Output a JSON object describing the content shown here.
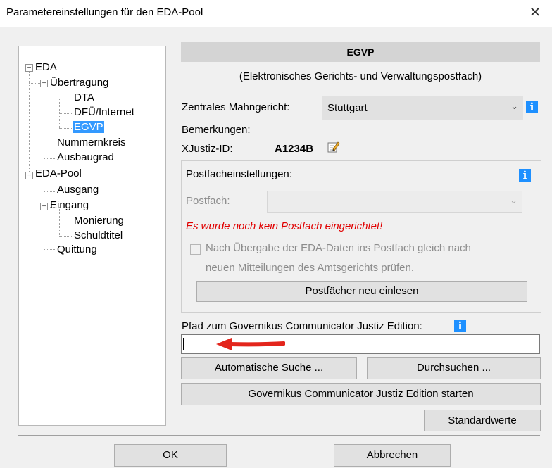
{
  "window": {
    "title": "Parametereinstellungen für den EDA-Pool",
    "close_glyph": "✕"
  },
  "tree": {
    "eda": "EDA",
    "uebertragung": "Übertragung",
    "dta": "DTA",
    "dfu": "DFÜ/Internet",
    "egvp": "EGVP",
    "nummernkreis": "Nummernkreis",
    "ausbaugrad": "Ausbaugrad",
    "eda_pool": "EDA-Pool",
    "ausgang": "Ausgang",
    "eingang": "Eingang",
    "monierung": "Monierung",
    "schuldtitel": "Schuldtitel",
    "quittung": "Quittung",
    "expanded_glyph": "−"
  },
  "panel": {
    "header": "EGVP",
    "subtitle": "(Elektronisches Gerichts- und Verwaltungspostfach)",
    "mahngericht_label": "Zentrales Mahngericht:",
    "mahngericht_value": "Stuttgart",
    "bemerkungen_label": "Bemerkungen:",
    "xjustiz_label": "XJustiz-ID:",
    "xjustiz_value": "A1234B",
    "info_glyph": "i",
    "chevron_glyph": "⌄"
  },
  "postfach": {
    "group_title": "Postfacheinstellungen:",
    "postfach_label": "Postfach:",
    "postfach_value": "",
    "error": "Es wurde noch kein Postfach eingerichtet!",
    "checkbox_line1": "Nach Übergabe der EDA-Daten ins Postfach gleich nach",
    "checkbox_line2": "neuen Mitteilungen des Amtsgerichts prüfen.",
    "checkbox_checked": false,
    "reload_button": "Postfächer neu einlesen"
  },
  "governikus": {
    "path_label": "Pfad zum Governikus Communicator Justiz Edition:",
    "path_value": "",
    "auto_search_button": "Automatische Suche ...",
    "browse_button": "Durchsuchen ...",
    "start_button": "Governikus Communicator Justiz Edition starten",
    "defaults_button": "Standardwerte"
  },
  "footer": {
    "ok_button": "OK",
    "cancel_button": "Abbrechen"
  },
  "colors": {
    "accent": "#1e90ff",
    "selection": "#3399ff",
    "error": "#e00000",
    "arrow": "#e3251c"
  }
}
